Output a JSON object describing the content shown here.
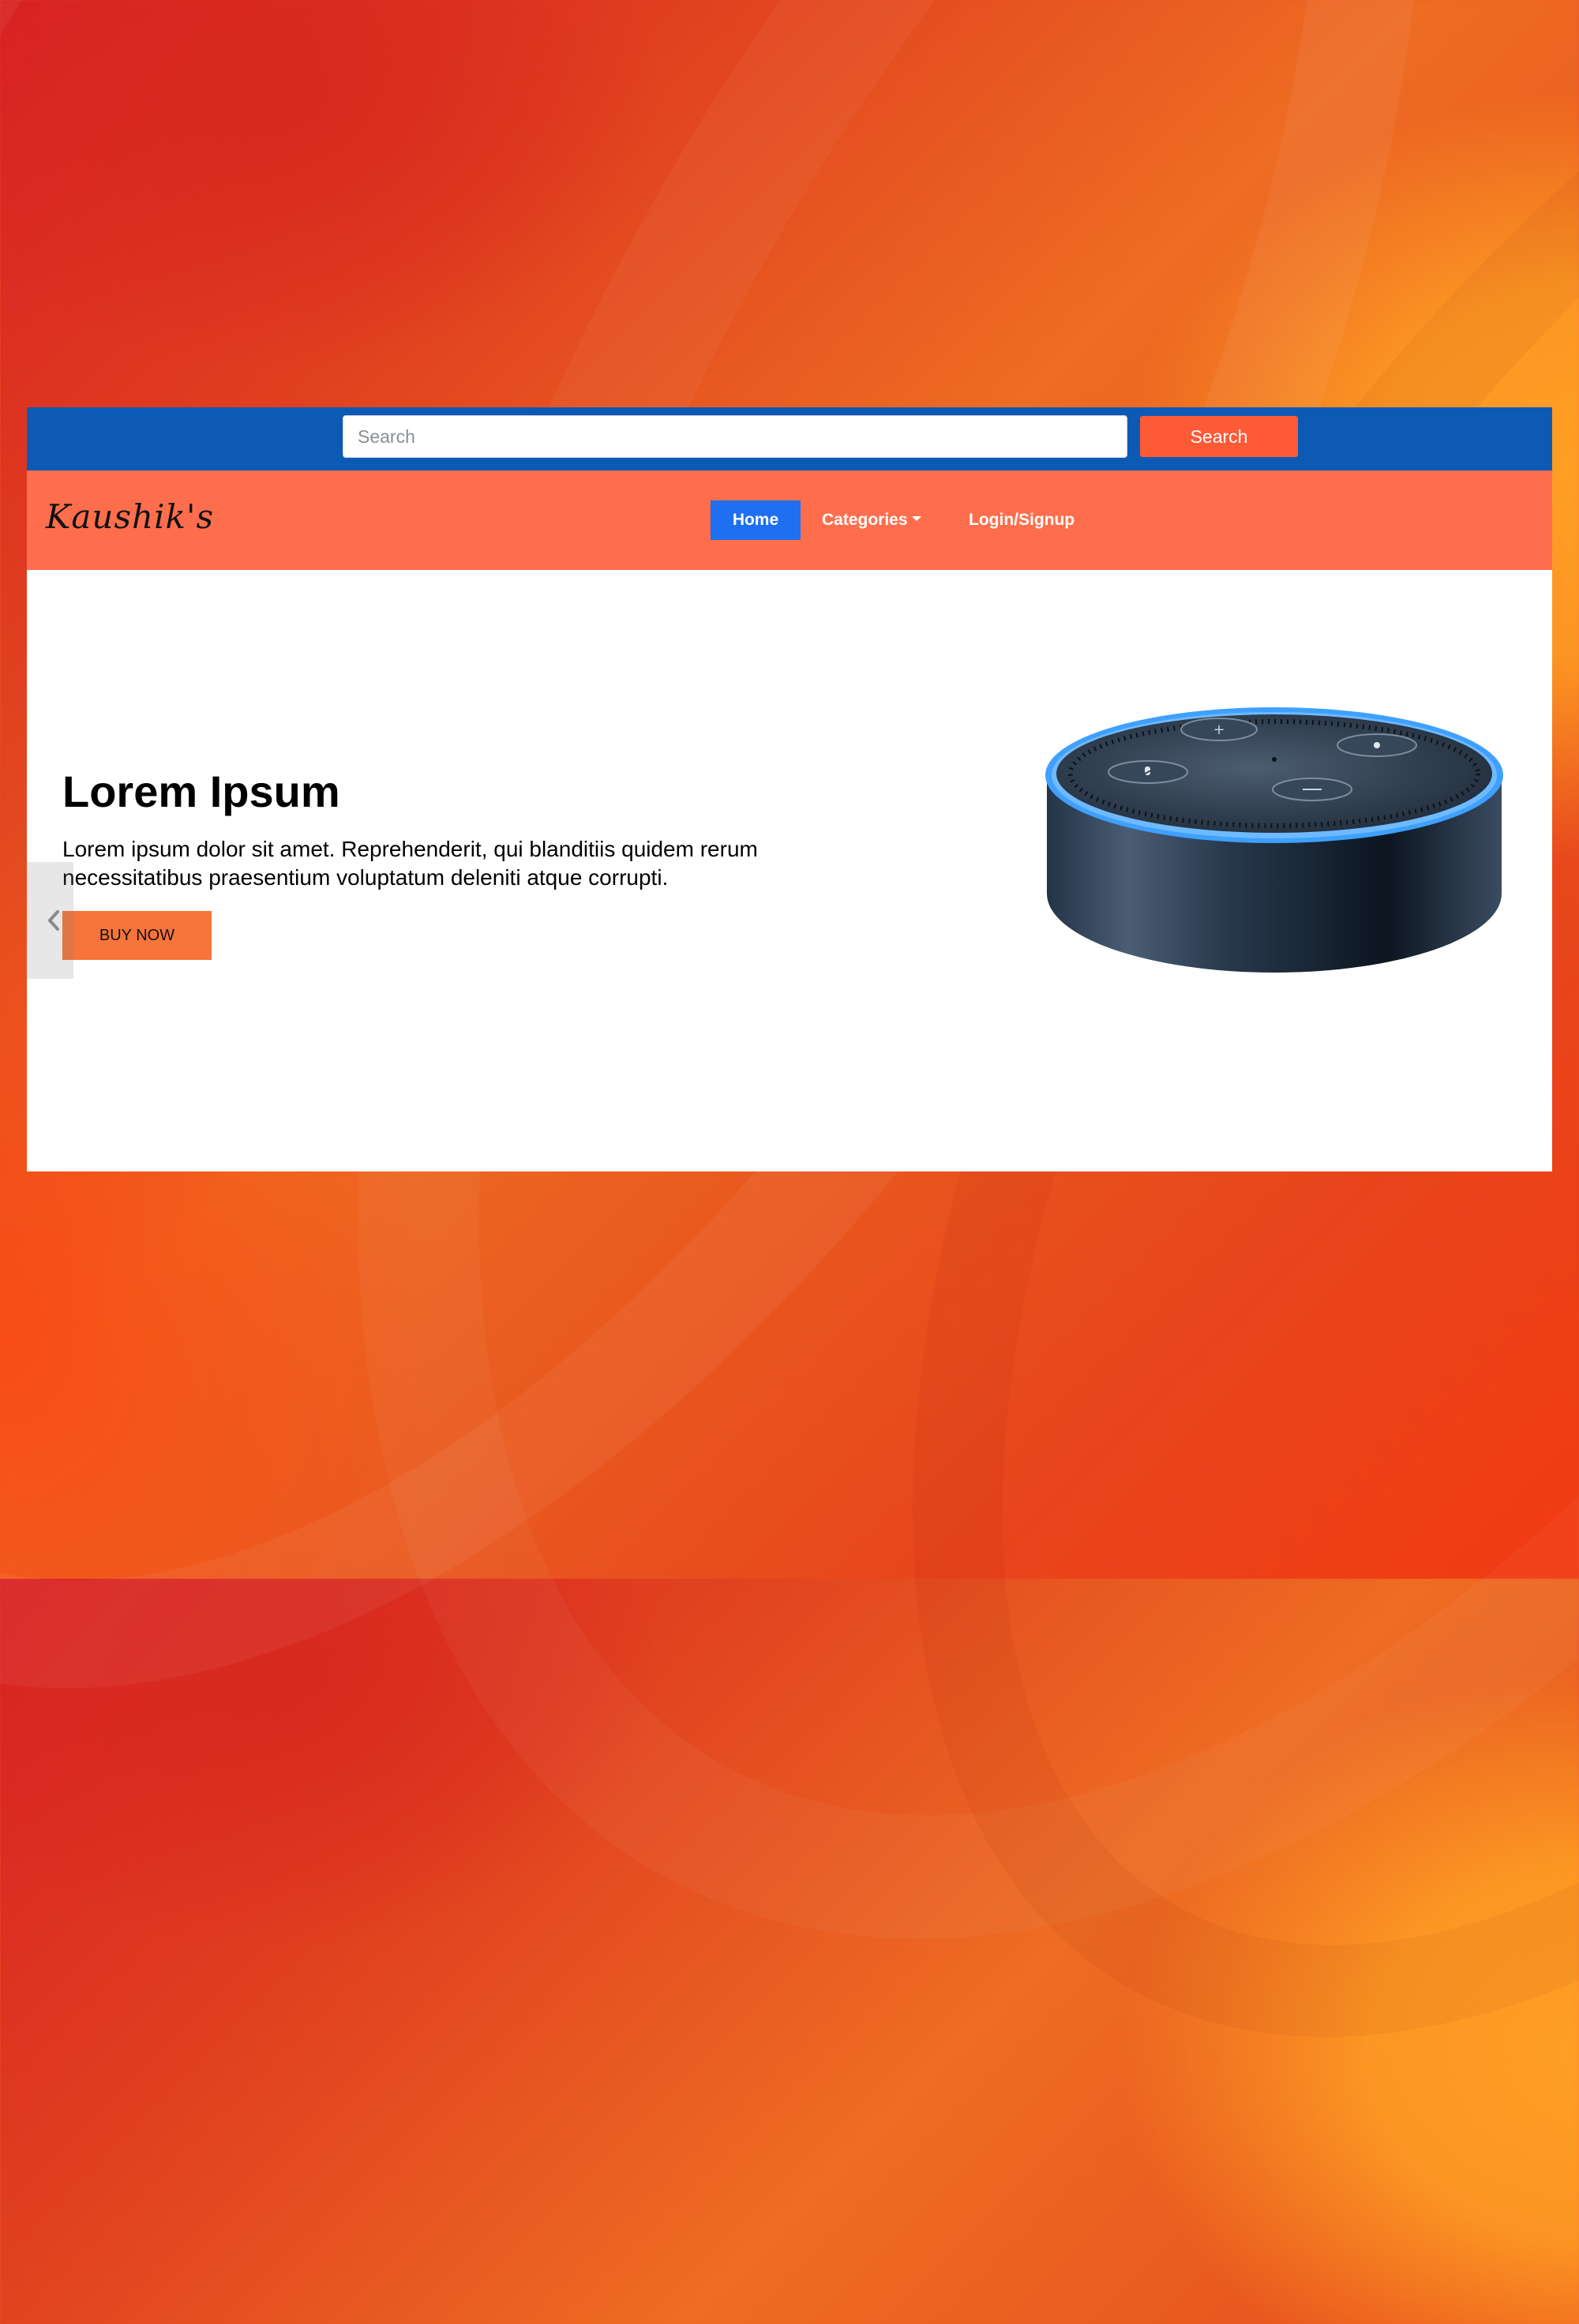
{
  "search": {
    "placeholder": "Search",
    "button_label": "Search"
  },
  "brand": {
    "name": "Kaushik's"
  },
  "nav": {
    "items": [
      {
        "label": "Home",
        "active": true
      },
      {
        "label": "Categories",
        "has_dropdown": true
      },
      {
        "label": "Login/Signup"
      }
    ]
  },
  "hero": {
    "title": "Lorem Ipsum",
    "text": "Lorem ipsum dolor sit amet. Reprehenderit, qui blanditiis quidem rerum necessitatibus praesentium voluptatum deleniti atque corrupti.",
    "button_label": "BUY NOW",
    "image": "smart-speaker"
  },
  "icons": {
    "carousel_prev": "chevron-left-icon"
  },
  "colors": {
    "topbar": "#0d5ab5",
    "navbar": "#ff6e4c",
    "search_button": "#ff5a36",
    "active_nav": "#1f6ff2",
    "buy_button": "#f7743a",
    "speaker_ring": "#3fa0ff"
  }
}
